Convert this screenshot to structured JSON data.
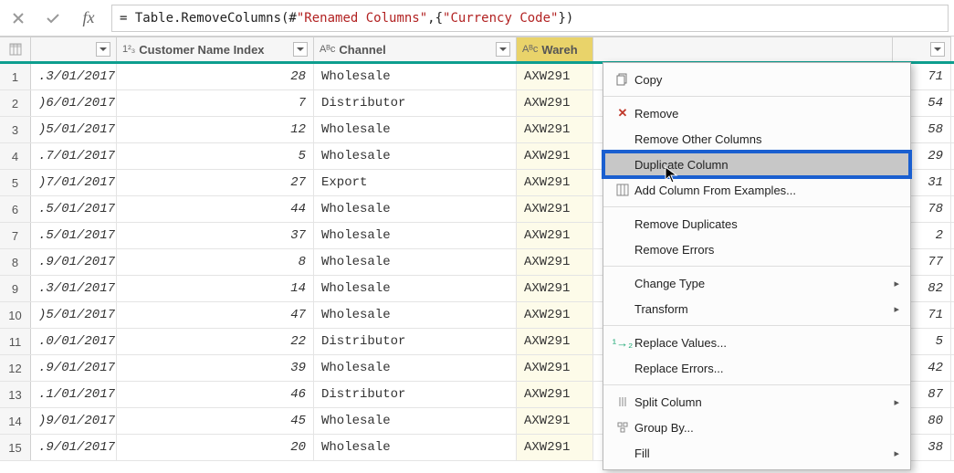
{
  "formula": {
    "prefix": "= Table.RemoveColumns(#",
    "quoted1": "\"Renamed Columns\"",
    "mid": ",{",
    "quoted2": "\"Currency Code\"",
    "suffix": "})"
  },
  "columns": {
    "date_type": "",
    "cust_type": "1²₃",
    "cust_label": "Customer Name Index",
    "chan_type": "Aᴮᴄ",
    "chan_label": "Channel",
    "wh_type": "Aᴮᴄ",
    "wh_label": "Wareh"
  },
  "rows": [
    {
      "n": "1",
      "date": ".3/01/2017",
      "cust": "28",
      "chan": "Wholesale",
      "wh": "AXW291",
      "num": "71"
    },
    {
      "n": "2",
      "date": ")6/01/2017",
      "cust": "7",
      "chan": "Distributor",
      "wh": "AXW291",
      "num": "54"
    },
    {
      "n": "3",
      "date": ")5/01/2017",
      "cust": "12",
      "chan": "Wholesale",
      "wh": "AXW291",
      "num": "58"
    },
    {
      "n": "4",
      "date": ".7/01/2017",
      "cust": "5",
      "chan": "Wholesale",
      "wh": "AXW291",
      "num": "29"
    },
    {
      "n": "5",
      "date": ")7/01/2017",
      "cust": "27",
      "chan": "Export",
      "wh": "AXW291",
      "num": "31"
    },
    {
      "n": "6",
      "date": ".5/01/2017",
      "cust": "44",
      "chan": "Wholesale",
      "wh": "AXW291",
      "num": "78"
    },
    {
      "n": "7",
      "date": ".5/01/2017",
      "cust": "37",
      "chan": "Wholesale",
      "wh": "AXW291",
      "num": "2"
    },
    {
      "n": "8",
      "date": ".9/01/2017",
      "cust": "8",
      "chan": "Wholesale",
      "wh": "AXW291",
      "num": "77"
    },
    {
      "n": "9",
      "date": ".3/01/2017",
      "cust": "14",
      "chan": "Wholesale",
      "wh": "AXW291",
      "num": "82"
    },
    {
      "n": "10",
      "date": ")5/01/2017",
      "cust": "47",
      "chan": "Wholesale",
      "wh": "AXW291",
      "num": "71"
    },
    {
      "n": "11",
      "date": ".0/01/2017",
      "cust": "22",
      "chan": "Distributor",
      "wh": "AXW291",
      "num": "5"
    },
    {
      "n": "12",
      "date": ".9/01/2017",
      "cust": "39",
      "chan": "Wholesale",
      "wh": "AXW291",
      "num": "42"
    },
    {
      "n": "13",
      "date": ".1/01/2017",
      "cust": "46",
      "chan": "Distributor",
      "wh": "AXW291",
      "num": "87"
    },
    {
      "n": "14",
      "date": ")9/01/2017",
      "cust": "45",
      "chan": "Wholesale",
      "wh": "AXW291",
      "num": "80"
    },
    {
      "n": "15",
      "date": ".9/01/2017",
      "cust": "20",
      "chan": "Wholesale",
      "wh": "AXW291",
      "num": "38"
    }
  ],
  "menu": {
    "copy": "Copy",
    "remove": "Remove",
    "remove_others": "Remove Other Columns",
    "duplicate": "Duplicate Column",
    "add_examples": "Add Column From Examples...",
    "remove_dupes": "Remove Duplicates",
    "remove_errors": "Remove Errors",
    "change_type": "Change Type",
    "transform": "Transform",
    "replace_values": "Replace Values...",
    "replace_errors": "Replace Errors...",
    "split_column": "Split Column",
    "group_by": "Group By...",
    "fill": "Fill"
  }
}
